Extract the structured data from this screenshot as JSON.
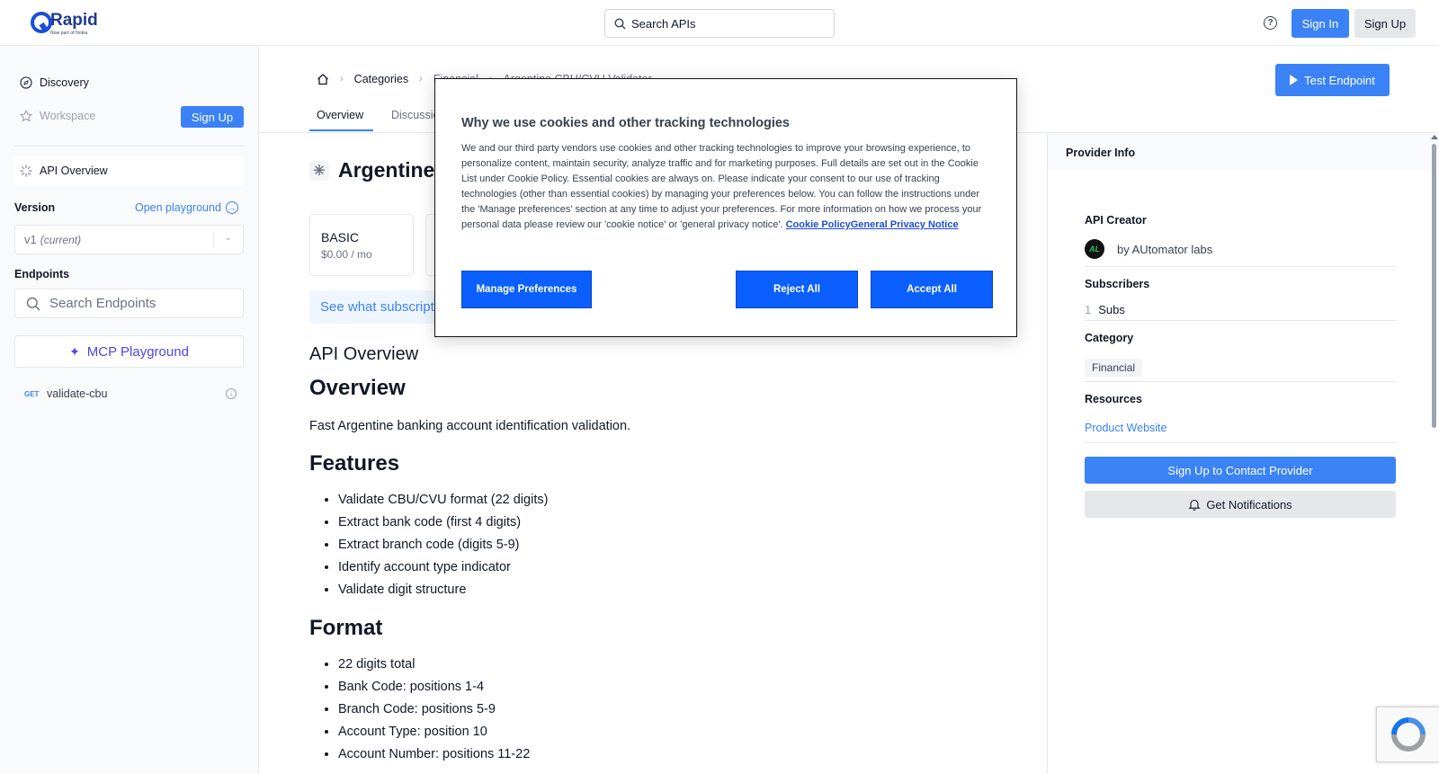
{
  "header": {
    "logo_text": "Rapid",
    "logo_sub": "Now part of Nokia",
    "search_placeholder": "Search APIs",
    "sign_in": "Sign In",
    "sign_up": "Sign Up"
  },
  "sidebar": {
    "discovery": "Discovery",
    "workspace": "Workspace",
    "sign_up": "Sign Up",
    "api_overview": "API Overview",
    "version_label": "Version",
    "open_playground": "Open playground",
    "version_value": "v1",
    "version_note": "(current)",
    "endpoints_label": "Endpoints",
    "search_endpoints": "Search Endpoints",
    "mcp_playground": "MCP Playground",
    "endpoints": [
      {
        "method": "GET",
        "name": "validate-cbu"
      }
    ]
  },
  "breadcrumb": {
    "categories": "Categories",
    "category": "Financial",
    "current": "Argentine CBU/CVU Validator"
  },
  "test_endpoint": "Test Endpoint",
  "tabs": [
    "Overview",
    "Discussions"
  ],
  "api": {
    "title": "Argentine",
    "plan_name": "BASIC",
    "plan_price": "$0.00 / mo",
    "see_what": "See what subscriptions"
  },
  "content": {
    "api_overview_heading": "API Overview",
    "overview_heading": "Overview",
    "overview_text": "Fast Argentine banking account identification validation.",
    "features_heading": "Features",
    "features": [
      "Validate CBU/CVU format (22 digits)",
      "Extract bank code (first 4 digits)",
      "Extract branch code (digits 5-9)",
      "Identify account type indicator",
      "Validate digit structure"
    ],
    "format_heading": "Format",
    "format": [
      "22 digits total",
      "Bank Code: positions 1-4",
      "Branch Code: positions 5-9",
      "Account Type: position 10",
      "Account Number: positions 11-22"
    ]
  },
  "provider": {
    "header": "Provider Info",
    "creator_label": "API Creator",
    "avatar_text": "AL",
    "creator": "by AUtomator labs",
    "subscribers_label": "Subscribers",
    "subs_count": "1",
    "subs_unit": "Subs",
    "category_label": "Category",
    "category": "Financial",
    "resources_label": "Resources",
    "product_website": "Product Website",
    "contact": "Sign Up to Contact Provider",
    "notifications": "Get Notifications"
  },
  "cookie": {
    "title": "Why we use cookies and other tracking technologies",
    "body": "We and our third party vendors use cookies and other tracking technologies to improve your browsing experience, to personalize content, maintain security, analyze traffic and for marketing purposes. Full details are set out in the Cookie List under Cookie Policy. Essential cookies are always on. Please indicate your consent to our use of tracking technologies (other than essential cookies) by managing your preferences below. You can follow the instructions under the 'Manage preferences' section at any time to adjust your preferences. For more information on how we process your personal data please review our 'cookie notice' or 'general privacy notice'.",
    "link1": "Cookie Policy",
    "link2": "General Privacy Notice",
    "manage": "Manage Preferences",
    "reject": "Reject All",
    "accept": "Accept All"
  },
  "colors": {
    "accent": "#3b82f6",
    "cookie_button": "#0b5fff"
  }
}
